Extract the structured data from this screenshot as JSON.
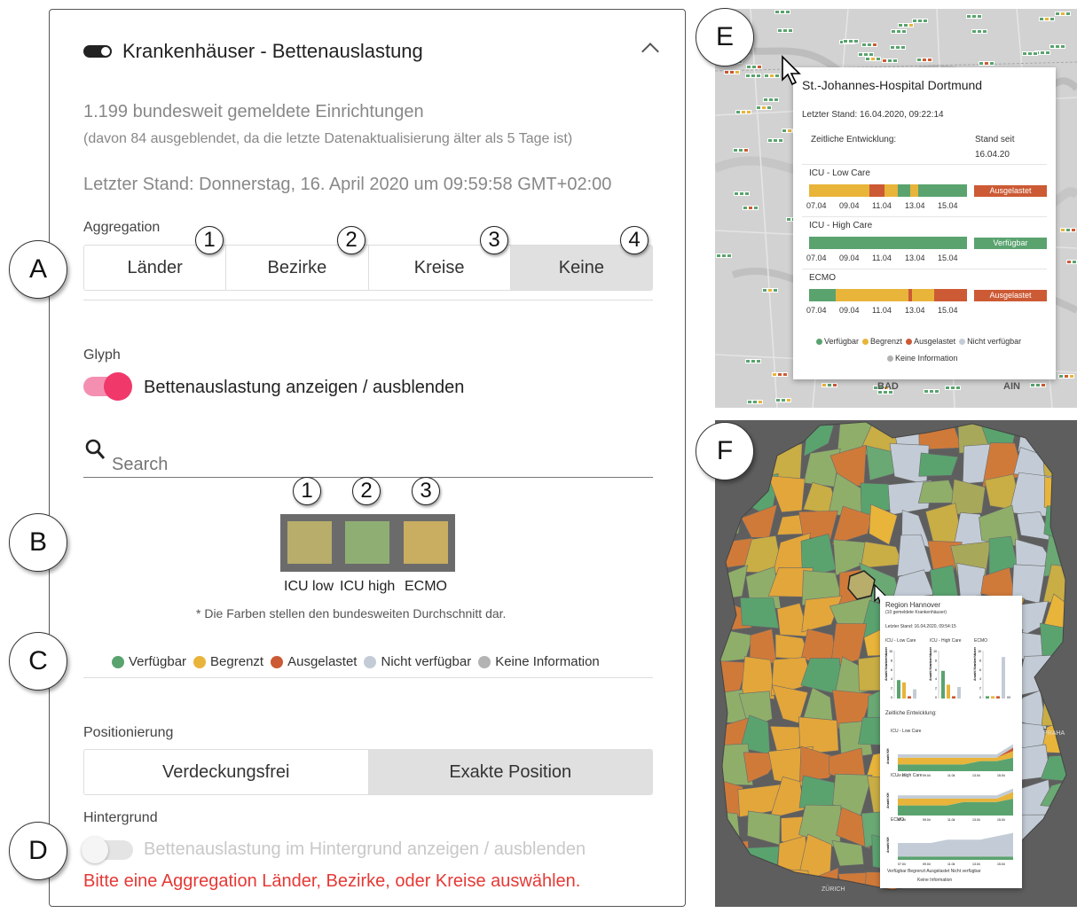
{
  "panel": {
    "title": "Krankenhäuser - Bettenauslastung",
    "count_line": "1.199 bundesweit gemeldete Einrichtungen",
    "count_sub": "(davon 84 ausgeblendet, da die letzte Datenaktualisierung älter als 5 Tage ist)",
    "stand_line": "Letzter Stand: Donnerstag, 16. April 2020 um 09:59:58 GMT+02:00",
    "aggregation": {
      "label": "Aggregation",
      "options": [
        "Länder",
        "Bezirke",
        "Kreise",
        "Keine"
      ],
      "selected": "Keine"
    },
    "glyph": {
      "label": "Glyph",
      "toggle_label": "Bettenauslastung anzeigen / ausblenden",
      "toggle_on": true
    },
    "search": {
      "placeholder": "Search"
    },
    "glyph_legend": {
      "labels": [
        "ICU low",
        "ICU high",
        "ECMO"
      ],
      "colors": [
        "#b8ad6a",
        "#8fae74",
        "#c9ad60"
      ],
      "note": "* Die Farben stellen den bundesweiten Durchschnitt dar."
    },
    "legend": [
      {
        "label": "Verfügbar",
        "color": "#5aa36f"
      },
      {
        "label": "Begrenzt",
        "color": "#e8b43a"
      },
      {
        "label": "Ausgelastet",
        "color": "#cc5a34"
      },
      {
        "label": "Nicht verfügbar",
        "color": "#c3ccd6"
      },
      {
        "label": "Keine Information",
        "color": "#b3b3b3"
      }
    ],
    "positioning": {
      "label": "Positionierung",
      "options": [
        "Verdeckungsfrei",
        "Exakte Position"
      ],
      "selected": "Exakte Position"
    },
    "background": {
      "label": "Hintergrund",
      "toggle_label": "Bettenauslastung im Hintergrund anzeigen / ausblenden",
      "toggle_on": false,
      "error": "Bitte eine Aggregation Länder, Bezirke, oder Kreise auswählen."
    }
  },
  "annotations": {
    "big": [
      "A",
      "B",
      "C",
      "D",
      "E",
      "F"
    ],
    "agg_numbers": [
      "1",
      "2",
      "3",
      "4"
    ],
    "glyph_numbers": [
      "1",
      "2",
      "3"
    ]
  },
  "map_e": {
    "hospital": "St.-Johannes-Hospital Dortmund",
    "stand": "Letzter Stand: 16.04.2020, 09:22:14",
    "entwicklung": "Zeitliche Entwicklung:",
    "stand_seit": "Stand seit",
    "stand_seit_date": "16.04.20",
    "ticks": [
      "07.04",
      "09.04",
      "11.04",
      "13.04",
      "15.04"
    ],
    "rows": [
      {
        "name": "ICU - Low Care",
        "status": "Ausgelastet",
        "status_color": "#cc5a34"
      },
      {
        "name": "ICU - High Care",
        "status": "Verfügbar",
        "status_color": "#5aa36f"
      },
      {
        "name": "ECMO",
        "status": "Ausgelastet",
        "status_color": "#cc5a34"
      }
    ],
    "map_labels": [
      "BAD",
      "AIN"
    ]
  },
  "map_f": {
    "region": "Region Hannover",
    "region_sub": "(10 gemeldete Krankenhäuser)",
    "stand": "Letzter Stand: 16.04.2020, 09:54:15",
    "cols": [
      "ICU - Low Care",
      "ICU - High Care",
      "ECMO"
    ],
    "axis_label": "Anzahl Krankenhäuser",
    "axis_ticks": [
      "10",
      "8",
      "6",
      "4",
      "2",
      "0"
    ],
    "entwicklung": "Zeitliche Entwicklung:",
    "rows": [
      "ICU - Low Care",
      "ICU - High Care",
      "ECMO"
    ],
    "anzahl_kh": "Anzahl KH",
    "ticks": [
      "07.04",
      "09.04",
      "11.04",
      "13.04",
      "15.04"
    ],
    "legend_line1": "Verfügbar  Begrenzt  Ausgelastet  Nicht verfügbar",
    "legend_line2": "Keine Information",
    "map_labels": [
      "PRAHA",
      "ZÜRICH"
    ]
  }
}
